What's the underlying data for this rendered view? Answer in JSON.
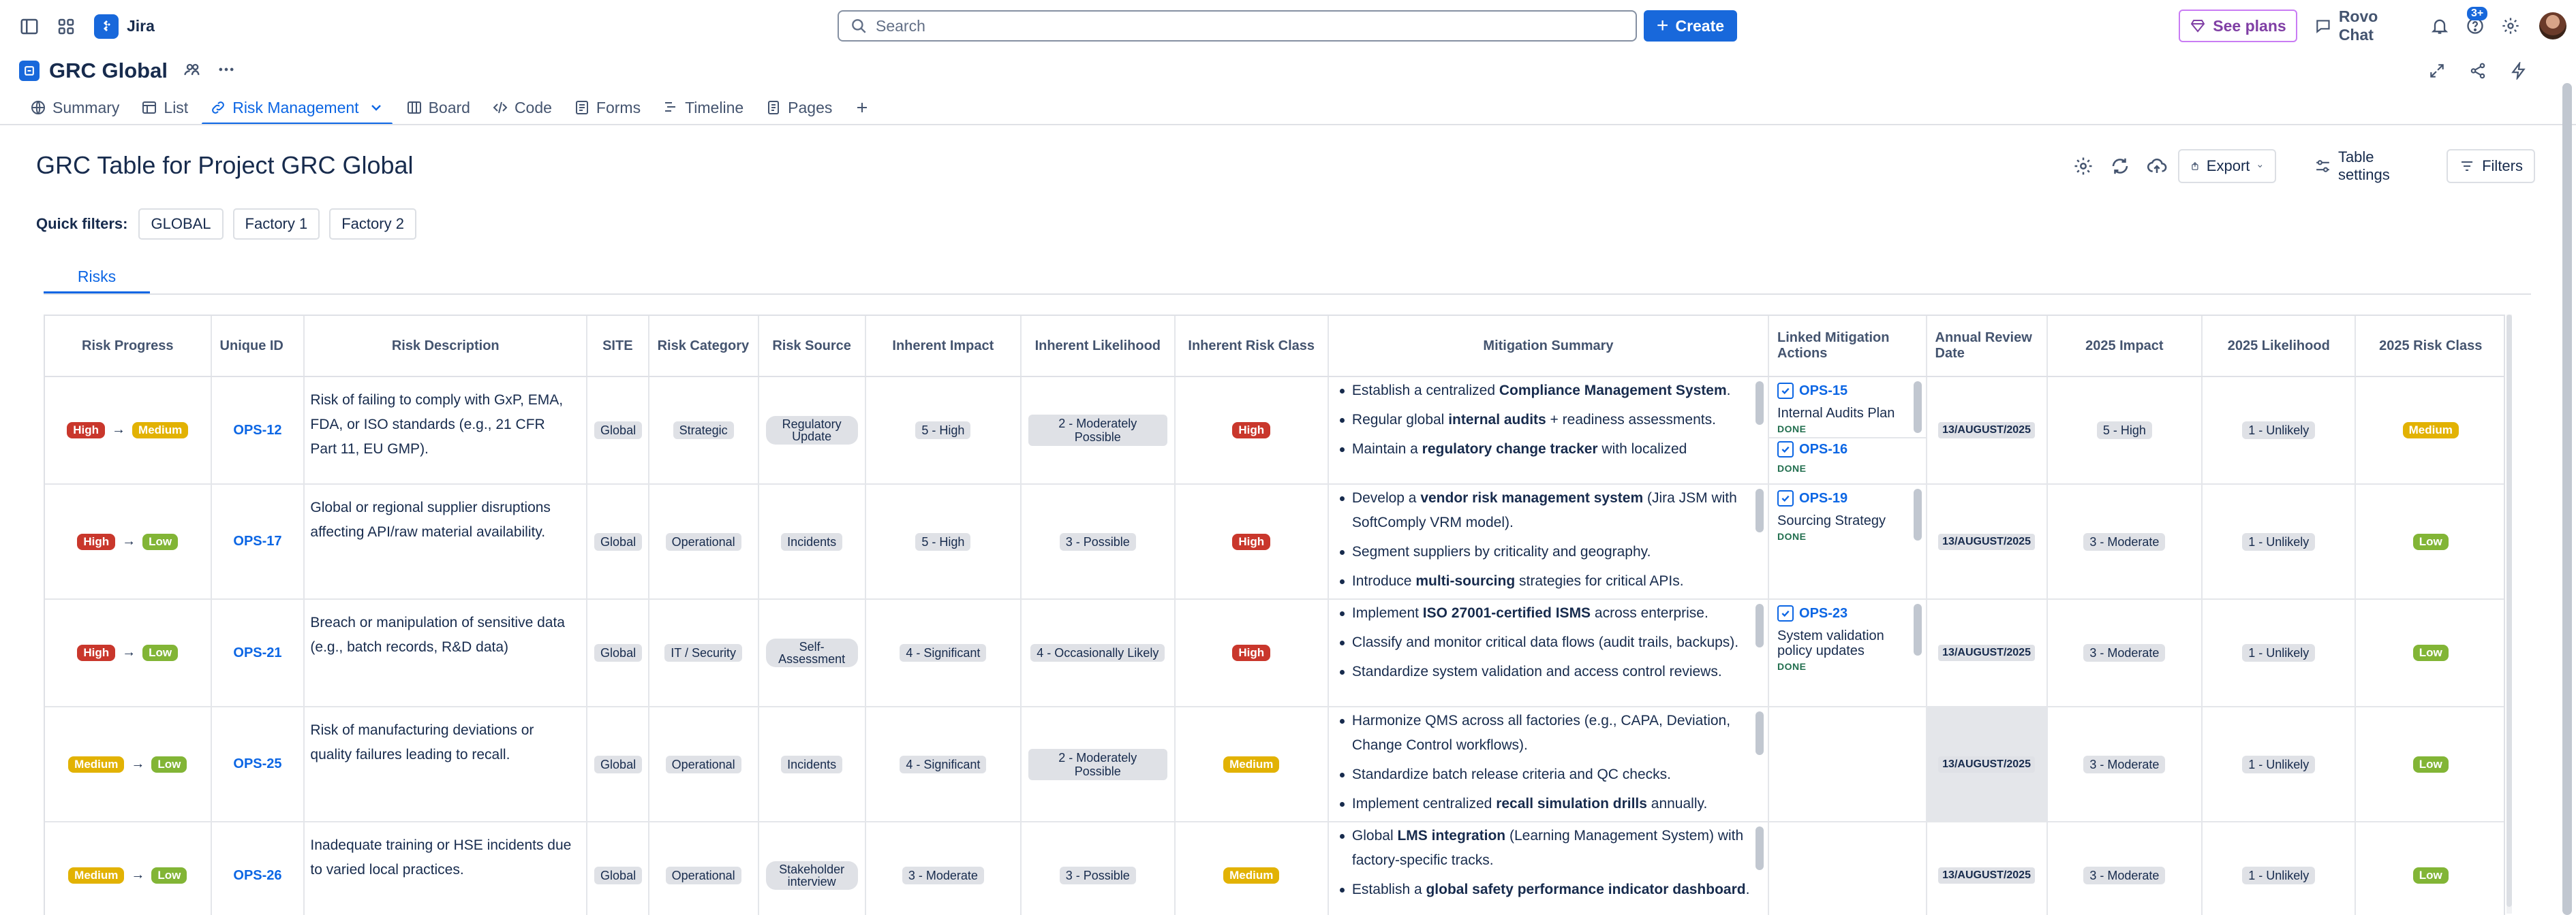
{
  "topbar": {
    "app_name": "Jira",
    "search_placeholder": "Search",
    "create_label": "Create",
    "see_plans_label": "See plans",
    "rovo_chat_label": "Rovo Chat",
    "help_badge": "3+"
  },
  "project": {
    "title": "GRC Global",
    "tabs": [
      {
        "label": "Summary",
        "icon": "globe-icon"
      },
      {
        "label": "List",
        "icon": "list-icon"
      },
      {
        "label": "Risk Management",
        "icon": "link-icon",
        "active": true
      },
      {
        "label": "Board",
        "icon": "board-icon"
      },
      {
        "label": "Code",
        "icon": "code-icon"
      },
      {
        "label": "Forms",
        "icon": "forms-icon"
      },
      {
        "label": "Timeline",
        "icon": "timeline-icon"
      },
      {
        "label": "Pages",
        "icon": "pages-icon"
      }
    ]
  },
  "page": {
    "title": "GRC Table for Project GRC Global",
    "export_label": "Export",
    "table_settings_label": "Table settings",
    "filters_label": "Filters",
    "quick_filters_label": "Quick filters:",
    "quick_filters": [
      "GLOBAL",
      "Factory 1",
      "Factory 2"
    ],
    "subtab": "Risks"
  },
  "colors": {
    "accent": "#1868db",
    "high": "#c9372c",
    "medium": "#e2b203",
    "low": "#82b536"
  },
  "table": {
    "headers": [
      "Risk Progress",
      "Unique ID",
      "Risk Description",
      "SITE",
      "Risk Category",
      "Risk Source",
      "Inherent Impact",
      "Inherent Likelihood",
      "Inherent Risk Class",
      "Mitigation Summary",
      "Linked Mitigation Actions",
      "Annual Review Date",
      "2025 Impact",
      "2025 Likelihood",
      "2025 Risk Class"
    ],
    "rows": [
      {
        "progress_from": "High",
        "progress_to": "Medium",
        "id": "OPS-12",
        "description": "Risk of failing to comply with GxP, EMA, FDA, or ISO standards (e.g., 21 CFR Part 11, EU GMP).",
        "site": "Global",
        "category": "Strategic",
        "source": "Regulatory Update",
        "inherent_impact": "5 - High",
        "inherent_likelihood": "2 - Moderately Possible",
        "inherent_class": "High",
        "mitigation": [
          {
            "pre": "Establish a centralized ",
            "bold": "Compliance Management System",
            "post": "."
          },
          {
            "pre": "Regular global ",
            "bold": "internal audits",
            "post": " + readiness assessments."
          },
          {
            "pre": "Maintain a ",
            "bold": "regulatory change tracker",
            "post": " with localized"
          }
        ],
        "linked": [
          {
            "key": "OPS-15",
            "summary": "Internal Audits Plan",
            "status": "DONE"
          },
          {
            "key": "OPS-16",
            "summary": "",
            "status": "DONE"
          }
        ],
        "review_date": "13/AUGUST/2025",
        "impact_2025": "5 - High",
        "likelihood_2025": "1 - Unlikely",
        "class_2025": "Medium"
      },
      {
        "progress_from": "High",
        "progress_to": "Low",
        "id": "OPS-17",
        "description": "Global or regional supplier disruptions affecting API/raw material availability.",
        "site": "Global",
        "category": "Operational",
        "source": "Incidents",
        "inherent_impact": "5 - High",
        "inherent_likelihood": "3 - Possible",
        "inherent_class": "High",
        "mitigation": [
          {
            "pre": "Develop a ",
            "bold": "vendor risk management system",
            "post": " (Jira JSM with SoftComply VRM model)."
          },
          {
            "pre": "Segment suppliers by criticality and geography.",
            "bold": "",
            "post": ""
          },
          {
            "pre": "Introduce ",
            "bold": "multi-sourcing",
            "post": " strategies for critical APIs."
          }
        ],
        "linked": [
          {
            "key": "OPS-19",
            "summary": "Sourcing Strategy",
            "status": "DONE"
          }
        ],
        "review_date": "13/AUGUST/2025",
        "impact_2025": "3 - Moderate",
        "likelihood_2025": "1 - Unlikely",
        "class_2025": "Low"
      },
      {
        "progress_from": "High",
        "progress_to": "Low",
        "id": "OPS-21",
        "description": "Breach or manipulation of sensitive data (e.g., batch records, R&D data)",
        "site": "Global",
        "category": "IT / Security",
        "source": "Self-Assessment",
        "inherent_impact": "4 - Significant",
        "inherent_likelihood": "4 - Occasionally Likely",
        "inherent_class": "High",
        "mitigation": [
          {
            "pre": "Implement ",
            "bold": "ISO 27001-certified ISMS",
            "post": " across enterprise."
          },
          {
            "pre": "Classify and monitor critical data flows (audit trails, backups).",
            "bold": "",
            "post": ""
          },
          {
            "pre": "Standardize system validation and access control reviews.",
            "bold": "",
            "post": ""
          }
        ],
        "linked": [
          {
            "key": "OPS-23",
            "summary": "System validation policy updates",
            "status": "DONE"
          }
        ],
        "review_date": "13/AUGUST/2025",
        "impact_2025": "3 - Moderate",
        "likelihood_2025": "1 - Unlikely",
        "class_2025": "Low"
      },
      {
        "progress_from": "Medium",
        "progress_to": "Low",
        "id": "OPS-25",
        "description": "Risk of manufacturing deviations or quality failures leading to recall.",
        "site": "Global",
        "category": "Operational",
        "source": "Incidents",
        "inherent_impact": "4 - Significant",
        "inherent_likelihood": "2 - Moderately Possible",
        "inherent_class": "Medium",
        "mitigation": [
          {
            "pre": "Harmonize QMS across all factories (e.g., CAPA, Deviation, Change Control workflows).",
            "bold": "",
            "post": ""
          },
          {
            "pre": "Standardize batch release criteria and QC checks.",
            "bold": "",
            "post": ""
          },
          {
            "pre": "Implement centralized ",
            "bold": "recall simulation drills",
            "post": " annually."
          }
        ],
        "linked": [],
        "review_date": "13/AUGUST/2025",
        "impact_2025": "3 - Moderate",
        "likelihood_2025": "1 - Unlikely",
        "class_2025": "Low"
      },
      {
        "progress_from": "Medium",
        "progress_to": "Low",
        "id": "OPS-26",
        "description": "Inadequate training or HSE incidents due to varied local practices.",
        "site": "Global",
        "category": "Operational",
        "source": "Stakeholder interview",
        "inherent_impact": "3 - Moderate",
        "inherent_likelihood": "3 - Possible",
        "inherent_class": "Medium",
        "mitigation": [
          {
            "pre": "Global ",
            "bold": "LMS integration",
            "post": " (Learning Management System) with factory-specific tracks."
          },
          {
            "pre": "Establish a ",
            "bold": "global safety performance indicator dashboard",
            "post": "."
          }
        ],
        "linked": [],
        "review_date": "13/AUGUST/2025",
        "impact_2025": "3 - Moderate",
        "likelihood_2025": "1 - Unlikely",
        "class_2025": "Low"
      }
    ]
  }
}
